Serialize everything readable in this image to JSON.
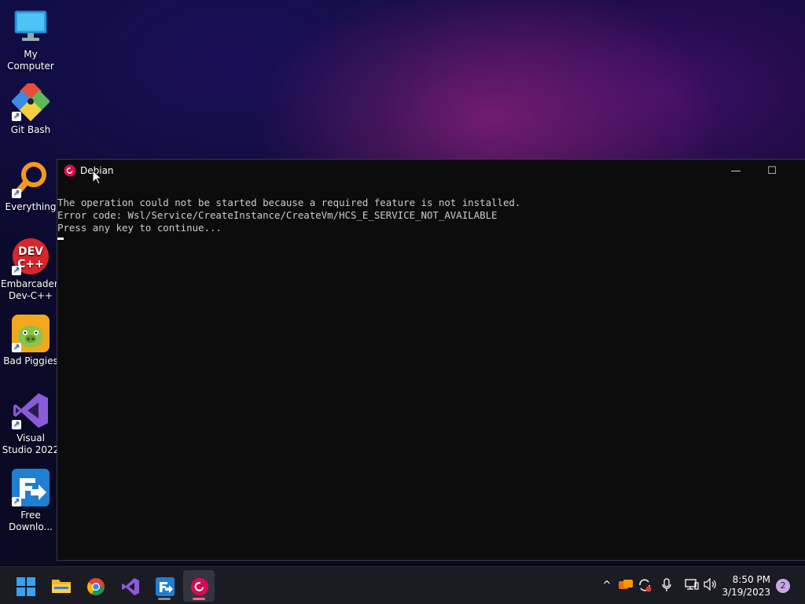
{
  "desktop": {
    "icons": [
      {
        "label": "My Computer"
      },
      {
        "label": "Git Bash"
      },
      {
        "label": "Everything"
      },
      {
        "label": "Embarcadero Dev-C++"
      },
      {
        "label": "Bad Piggies"
      },
      {
        "label": "Visual Studio 2022"
      },
      {
        "label": "Free Downlo..."
      }
    ]
  },
  "terminal": {
    "title": "Debian",
    "lines": [
      "The operation could not be started because a required feature is not installed.",
      "Error code: Wsl/Service/CreateInstance/CreateVm/HCS_E_SERVICE_NOT_AVAILABLE",
      "Press any key to continue..."
    ],
    "minimize_glyph": "—",
    "maximize_glyph": "☐",
    "close_glyph": "✕"
  },
  "taskbar": {
    "apps": [
      {
        "name": "start"
      },
      {
        "name": "file-explorer"
      },
      {
        "name": "chrome"
      },
      {
        "name": "visual-studio"
      },
      {
        "name": "free-download-manager"
      },
      {
        "name": "debian"
      }
    ],
    "clock": {
      "time": "8:50 PM",
      "date": "3/19/2023"
    },
    "notification_count": "2"
  }
}
